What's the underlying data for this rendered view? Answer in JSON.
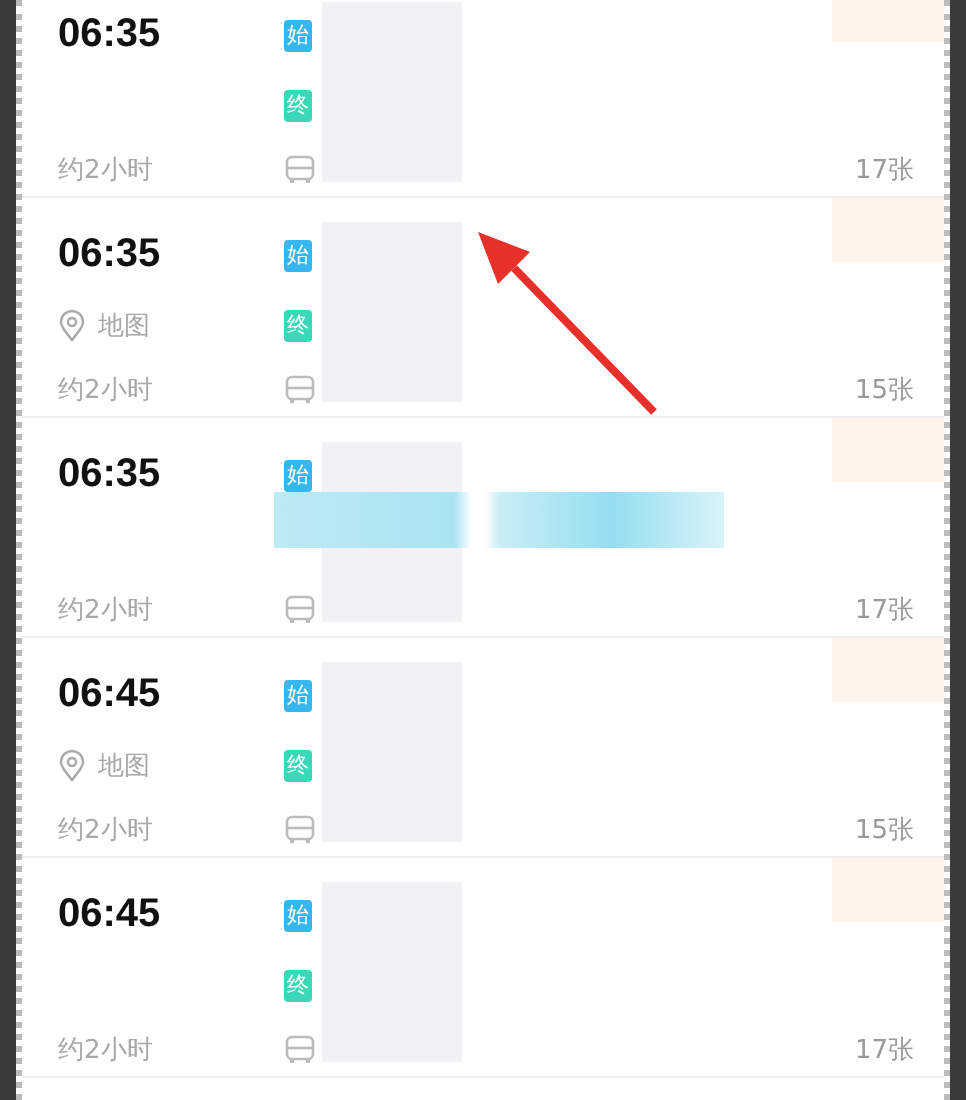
{
  "rows": [
    {
      "time": "06:35",
      "start_tag": "始",
      "end_tag": "终",
      "duration": "约2小时",
      "tickets": "17张",
      "smudged": false
    },
    {
      "time": "06:35",
      "start_tag": "始",
      "end_tag": "终",
      "map": "地图",
      "duration": "约2小时",
      "tickets": "15张",
      "smudged": false
    },
    {
      "time": "06:35",
      "start_tag": "始",
      "duration": "约2小时",
      "tickets": "17张",
      "smudged": true
    },
    {
      "time": "06:45",
      "start_tag": "始",
      "end_tag": "终",
      "map": "地图",
      "duration": "约2小时",
      "tickets": "15张",
      "smudged": false
    },
    {
      "time": "06:45",
      "start_tag": "始",
      "end_tag": "终",
      "duration": "约2小时",
      "tickets": "17张",
      "smudged": false
    }
  ],
  "annotation": {
    "kind": "arrow"
  }
}
